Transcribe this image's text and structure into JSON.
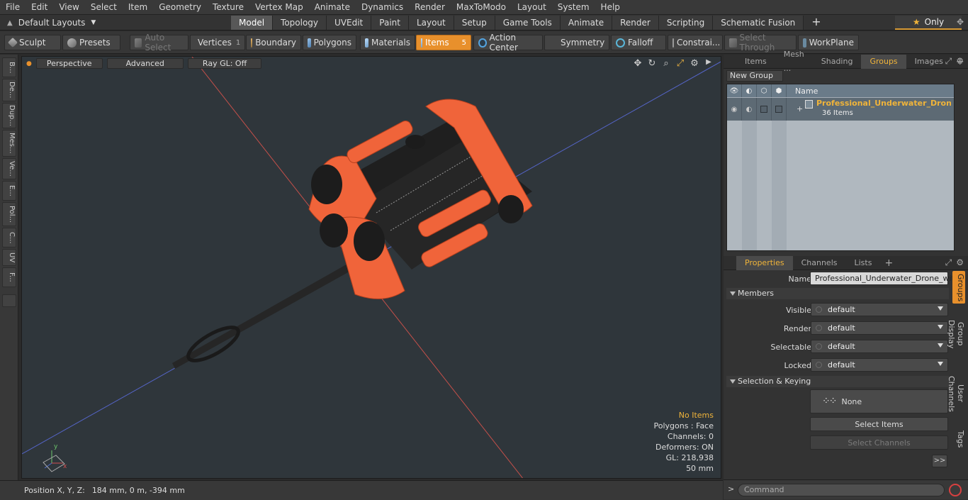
{
  "menu": [
    "File",
    "Edit",
    "View",
    "Select",
    "Item",
    "Geometry",
    "Texture",
    "Vertex Map",
    "Animate",
    "Dynamics",
    "Render",
    "MaxToModo",
    "Layout",
    "System",
    "Help"
  ],
  "layout_selector": "Default Layouts",
  "tabs": [
    {
      "label": "Model",
      "active": true
    },
    {
      "label": "Topology"
    },
    {
      "label": "UVEdit"
    },
    {
      "label": "Paint"
    },
    {
      "label": "Layout"
    },
    {
      "label": "Setup"
    },
    {
      "label": "Game Tools"
    },
    {
      "label": "Animate"
    },
    {
      "label": "Render"
    },
    {
      "label": "Scripting"
    },
    {
      "label": "Schematic Fusion"
    }
  ],
  "tab_plus": "+",
  "only_label": "Only",
  "toolbar": {
    "sculpt": "Sculpt",
    "presets": "Presets",
    "auto_select": "Auto Select",
    "vertices": "Vertices",
    "vertices_count": "1",
    "boundary": "Boundary",
    "polygons": "Polygons",
    "materials": "Materials",
    "items": "Items",
    "items_count": "5",
    "action_center": "Action Center",
    "symmetry": "Symmetry",
    "falloff": "Falloff",
    "constraints": "Constrai...",
    "select_through": "Select Through",
    "workplane": "WorkPlane"
  },
  "left_tabs": [
    "B...",
    "De...",
    "Dup...",
    "Mes...",
    "Ve...",
    "E...",
    "Pol...",
    "C...",
    "UV",
    "F..."
  ],
  "viewport": {
    "perspective": "Perspective",
    "advanced": "Advanced",
    "raygl": "Ray GL: Off",
    "stats": {
      "no_items": "No Items",
      "polygons": "Polygons : Face",
      "channels": "Channels: 0",
      "deformers": "Deformers: ON",
      "gl": "GL: 218,938",
      "scale": "50 mm"
    }
  },
  "status": {
    "position_label": "Position X, Y, Z:",
    "position_value": "184 mm, 0 m, -394 mm"
  },
  "top_panel": {
    "tabs": [
      {
        "label": "Items"
      },
      {
        "label": "Mesh ..."
      },
      {
        "label": "Shading"
      },
      {
        "label": "Groups",
        "active": true
      },
      {
        "label": "Images"
      }
    ],
    "new_group": "New Group",
    "name_header": "Name",
    "group_name": "Professional_Underwater_Dron ...",
    "group_count": "36 Items"
  },
  "props_panel": {
    "tabs": [
      {
        "label": "Properties",
        "active": true
      },
      {
        "label": "Channels"
      },
      {
        "label": "Lists"
      }
    ],
    "name_label": "Name",
    "name_value": "Professional_Underwater_Drone_with",
    "members": "Members",
    "visible_label": "Visible",
    "visible_value": "default",
    "render_label": "Render",
    "render_value": "default",
    "selectable_label": "Selectable",
    "selectable_value": "default",
    "locked_label": "Locked",
    "locked_value": "default",
    "selection_keying": "Selection & Keying",
    "none": "None",
    "select_items": "Select Items",
    "select_channels": "Select Channels",
    "more": ">>",
    "side_tabs": [
      {
        "label": "Groups",
        "active": true
      },
      {
        "label": "Group Display"
      },
      {
        "label": "User Channels"
      },
      {
        "label": "Tags"
      }
    ]
  },
  "command_placeholder": "Command",
  "colors": {
    "accent": "#e8902c",
    "orange_model": "#f0643a",
    "viewport_bg": "#2f363b"
  }
}
